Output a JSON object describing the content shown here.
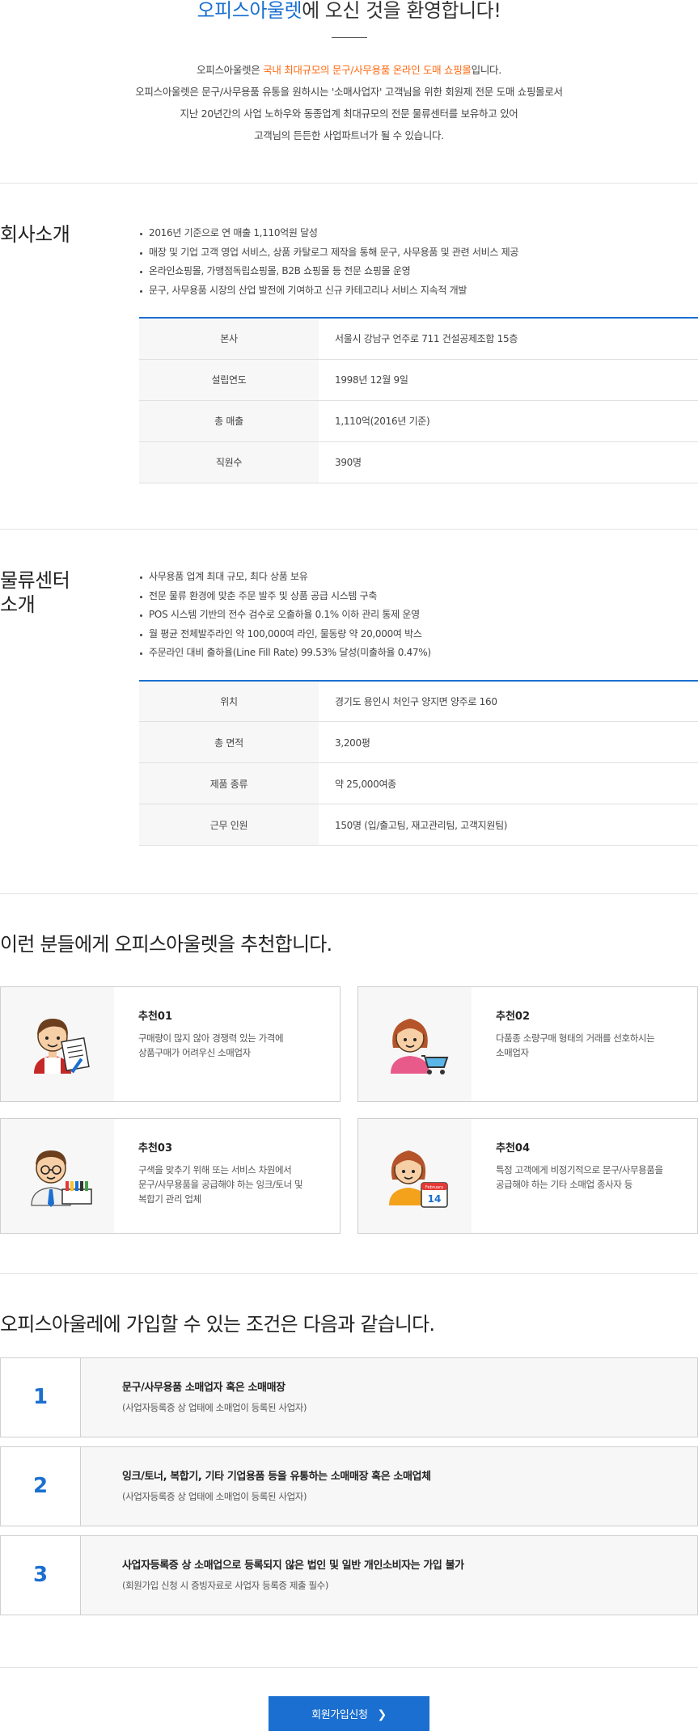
{
  "welcome": {
    "title_accent": "오피스아울렛",
    "title_rest": "에 오신 것을 환영합니다!",
    "line1_pre": "오피스아울렛은 ",
    "line1_highlight": "국내 최대규모의 문구/사무용품 온라인 도매 쇼핑몰",
    "line1_post": "입니다.",
    "line2": "오피스아울렛은 문구/사무용품 유통을 원하시는 '소매사업자' 고객님을 위한 회원제 전문 도매 쇼핑몰로서",
    "line3": "지난 20년간의 사업 노하우와 동종업계 최대규모의 전문 물류센터를 보유하고 있어",
    "line4": "고객님의 든든한 사업파트너가 될 수 있습니다."
  },
  "company": {
    "title": "회사소개",
    "bullets": [
      "2016년 기준으로 연 매출 1,110억원 달성",
      "매장 및 기업 고객 영업 서비스, 상품 카탈로그 제작을 통해 문구, 사무용품 및 관련 서비스 제공",
      "온라인쇼핑몰, 가맹점독립쇼핑몰, B2B 쇼핑몰 등 전문 쇼핑몰 운영",
      "문구, 사무용품 시장의 산업 발전에 기여하고 신규 카테고리나 서비스 지속적 개발"
    ],
    "rows": [
      {
        "k": "본사",
        "v": "서울시 강남구 언주로 711 건설공제조합 15층"
      },
      {
        "k": "설립연도",
        "v": "1998년 12월 9일"
      },
      {
        "k": "총 매출",
        "v": "1,110억(2016년 기준)"
      },
      {
        "k": "직원수",
        "v": "390명"
      }
    ]
  },
  "center": {
    "title_line1": "물류센터",
    "title_line2": "소개",
    "bullets": [
      "사무용품 업계 최대 규모, 최다 상품 보유",
      "전문 물류 환경에 맞춘 주문 발주 및 상품 공급 시스템 구축",
      "POS 시스템 기반의 전수 검수로 오출하율 0.1% 이하 관리 통제 운영",
      "월 평균 전체발주라인 약 100,000여 라인, 물동량 약 20,000여 박스",
      "주문라인 대비 출하율(Line Fill Rate) 99.53% 달성(미출하율 0.47%)"
    ],
    "rows": [
      {
        "k": "위치",
        "v": "경기도 용인시 처인구 양지면 양주로 160"
      },
      {
        "k": "총 면적",
        "v": "3,200평"
      },
      {
        "k": "제품 종류",
        "v": "약 25,000여종"
      },
      {
        "k": "근무 인원",
        "v": "150명 (입/출고팀, 재고관리팀, 고객지원팀)"
      }
    ]
  },
  "recommend": {
    "title": "이런 분들에게 오피스아울렛을 추천합니다.",
    "cards": [
      {
        "title": "추천01",
        "d1": "구매량이 많지 않아 경쟁력 있는 가격에",
        "d2": "상품구매가 어려우신 소매업자",
        "d3": ""
      },
      {
        "title": "추천02",
        "d1": "다품종 소량구매 형태의 거래를 선호하시는",
        "d2": "소매업자",
        "d3": ""
      },
      {
        "title": "추천03",
        "d1": "구색을 맞추기 위해 또는 서비스 차원에서",
        "d2": "문구/사무용품을 공급해야 하는 잉크/토너 및",
        "d3": "복합기 관리 업체"
      },
      {
        "title": "추천04",
        "d1": "특정 고객에게 비정기적으로 문구/사무용품을",
        "d2": "공급해야 하는 기타 소매업 종사자 등",
        "d3": ""
      }
    ],
    "calendar_month": "February",
    "calendar_day": "14"
  },
  "conditions": {
    "title": "오피스아울레에 가입할 수 있는 조건은 다음과 같습니다.",
    "items": [
      {
        "num": "1",
        "main": "문구/사무용품 소매업자 혹은 소매매장",
        "sub": "(사업자등록증 상 업태에 소매업이 등록된 사업자)"
      },
      {
        "num": "2",
        "main": "잉크/토너, 복합기, 기타 기업용품 등을 유통하는 소매매장 혹은 소매업체",
        "sub": "(사업자등록증 상 업태에 소매업이 등록된 사업자)"
      },
      {
        "num": "3",
        "main": "사업자등록증 상 소매업으로 등록되지 않은 법인 및 일반 개인소비자는 가입 불가",
        "sub": "(회원가입 신청 시 증빙자료로 사업자 등록증 제출 필수)"
      }
    ]
  },
  "join": {
    "label": "회원가입신청",
    "chevron": "❯"
  },
  "colors": {
    "accent": "#1a6fd0",
    "highlight": "#ff6a13"
  }
}
